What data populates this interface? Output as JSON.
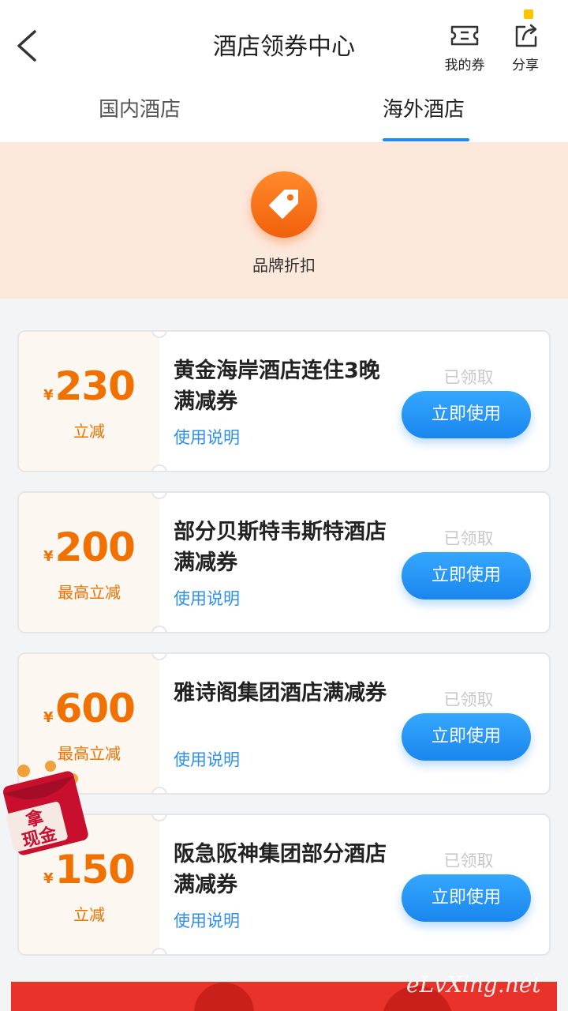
{
  "header": {
    "title": "酒店领券中心",
    "my_coupons_label": "我的券",
    "share_label": "分享"
  },
  "tabs": [
    {
      "label": "国内酒店",
      "active": false
    },
    {
      "label": "海外酒店",
      "active": true
    }
  ],
  "brand": {
    "label": "品牌折扣",
    "icon": "tag-icon"
  },
  "coupons": [
    {
      "currency": "¥",
      "amount": "230",
      "amount_label": "立减",
      "title": "黄金海岸酒店连住3晚满减券",
      "link": "使用说明",
      "status": "已领取",
      "button": "立即使用"
    },
    {
      "currency": "¥",
      "amount": "200",
      "amount_label": "最高立减",
      "title": "部分贝斯特韦斯特酒店满减券",
      "link": "使用说明",
      "status": "已领取",
      "button": "立即使用"
    },
    {
      "currency": "¥",
      "amount": "600",
      "amount_label": "最高立减",
      "title": "雅诗阁集团酒店满减券",
      "link": "使用说明",
      "status": "已领取",
      "button": "立即使用"
    },
    {
      "currency": "¥",
      "amount": "150",
      "amount_label": "立减",
      "title": "阪急阪神集团部分酒店满减券",
      "link": "使用说明",
      "status": "已领取",
      "button": "立即使用"
    }
  ],
  "promo_badge": {
    "text_top": "拿",
    "text_bottom": "现金"
  },
  "watermark": "eLvXing.net",
  "colors": {
    "accent_blue": "#1a8cff",
    "amount_orange": "#f07000",
    "brand_panel": "#fde8dc"
  }
}
